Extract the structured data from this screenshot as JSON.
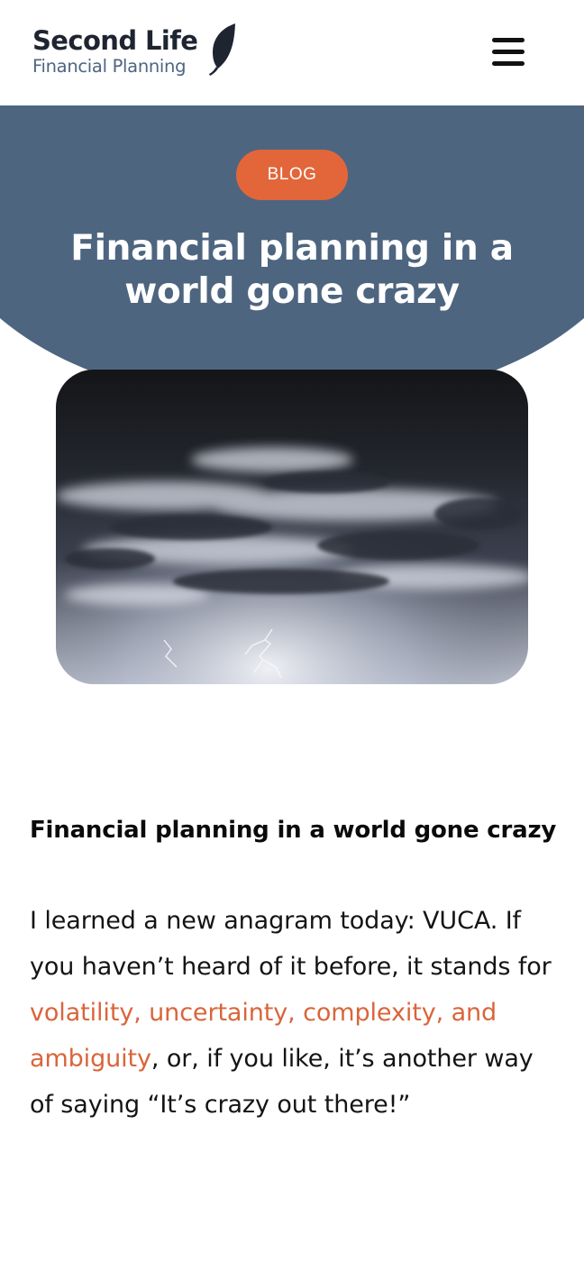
{
  "header": {
    "logo": {
      "name": "Second Life",
      "tagline": "Financial Planning"
    },
    "menu_icon": "hamburger-menu-icon"
  },
  "hero": {
    "badge": "BLOG",
    "title": "Financial planning in a world gone crazy",
    "background_color": "#4e6580",
    "badge_color": "#e2663a",
    "image": "stormy-clouds-with-lightning"
  },
  "article": {
    "heading": "Financial planning in a world gone crazy",
    "paragraph": {
      "text_before": "I learned a new anagram today: VUCA. If you haven’t heard of it before, it stands for ",
      "link_text": "volatility, uncertainty, complexity, and ambiguity",
      "text_after": ", or, if you like, it’s another way of saying “It’s crazy out there!”"
    },
    "link_color": "#d9653a"
  }
}
